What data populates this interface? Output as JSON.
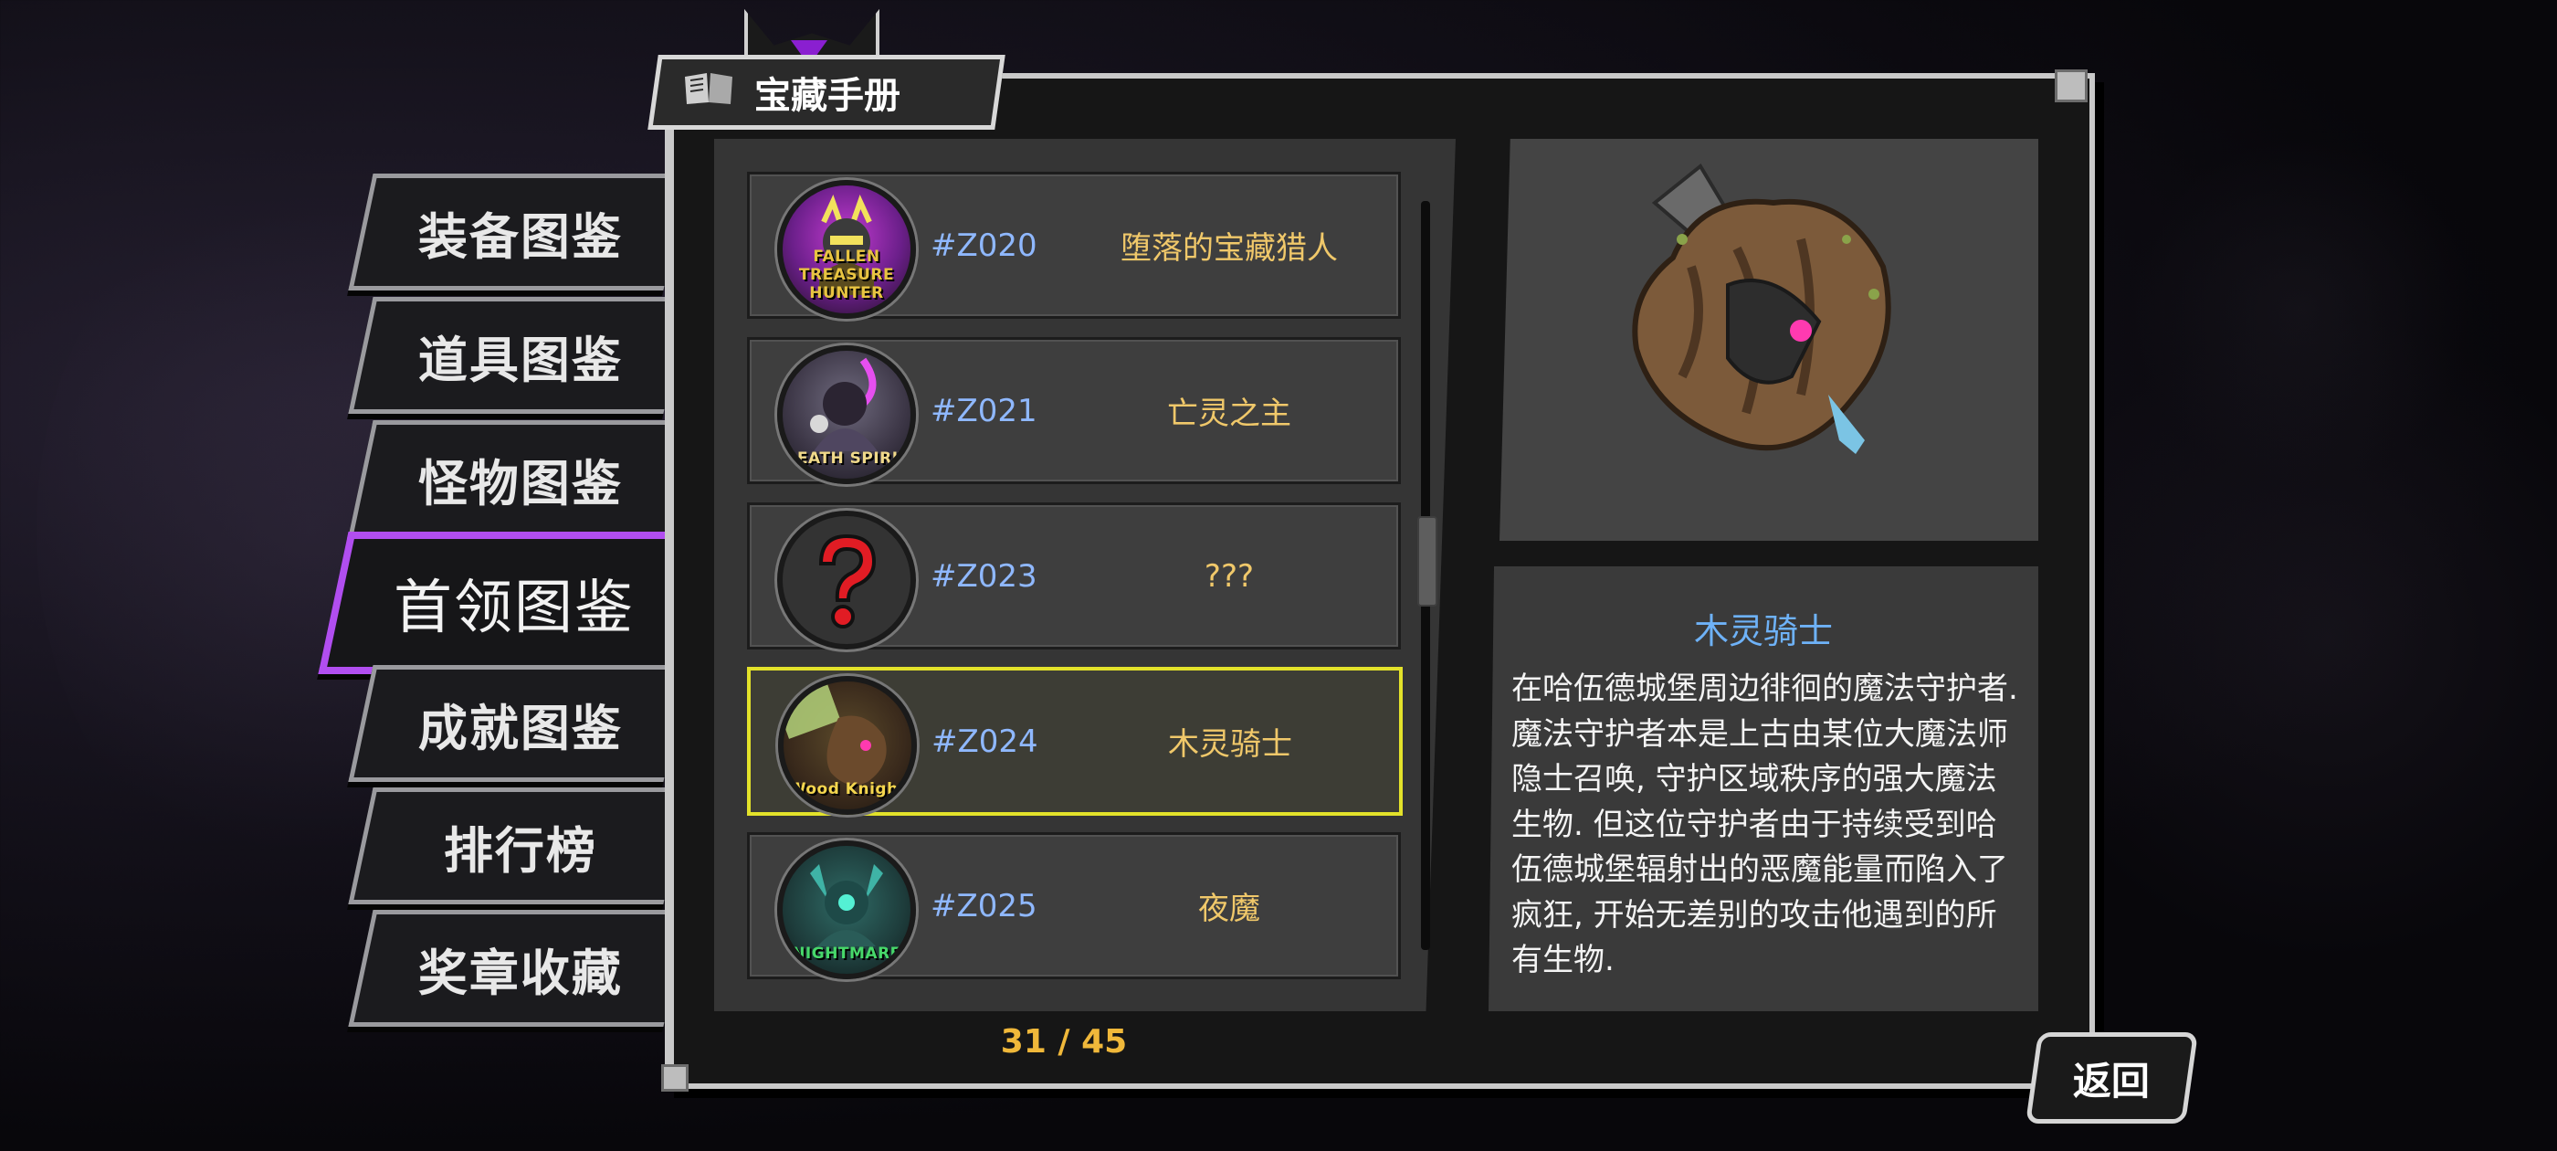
{
  "title": "宝藏手册",
  "menu": [
    {
      "label": "装备图鉴"
    },
    {
      "label": "道具图鉴"
    },
    {
      "label": "怪物图鉴"
    },
    {
      "label": "首领图鉴",
      "active": true
    },
    {
      "label": "成就图鉴"
    },
    {
      "label": "排行榜"
    },
    {
      "label": "奖章收藏"
    }
  ],
  "list": [
    {
      "id": "#Z020",
      "name": "堕落的宝藏猎人",
      "thumb_label": "FALLEN TREASURE HUNTER",
      "thumb_color": "#e8c441"
    },
    {
      "id": "#Z021",
      "name": "亡灵之主",
      "thumb_label": "DEATH SPIRIT",
      "thumb_color": "#f0d98a"
    },
    {
      "id": "#Z023",
      "name": "???",
      "thumb_label": "",
      "thumb_color": "#e11c24"
    },
    {
      "id": "#Z024",
      "name": "木灵骑士",
      "thumb_label": "Wood Knight",
      "thumb_color": "#f4d64e",
      "selected": true
    },
    {
      "id": "#Z025",
      "name": "夜魔",
      "thumb_label": "NIGHTMARE",
      "thumb_color": "#47d86a"
    }
  ],
  "page_counter": "31 / 45",
  "detail": {
    "name": "木灵骑士",
    "description": "在哈伍德城堡周边徘徊的魔法守护者. 魔法守护者本是上古由某位大魔法师隐士召唤, 守护区域秩序的强大魔法生物. 但这位守护者由于持续受到哈伍德城堡辐射出的恶魔能量而陷入了疯狂, 开始无差别的攻击他遇到的所有生物."
  },
  "back_label": "返回",
  "colors": {
    "accent_purple": "#b14ef0",
    "selected_yellow": "#e3e22a",
    "id_blue": "#8fb8ff",
    "name_gold": "#f0c86a"
  }
}
